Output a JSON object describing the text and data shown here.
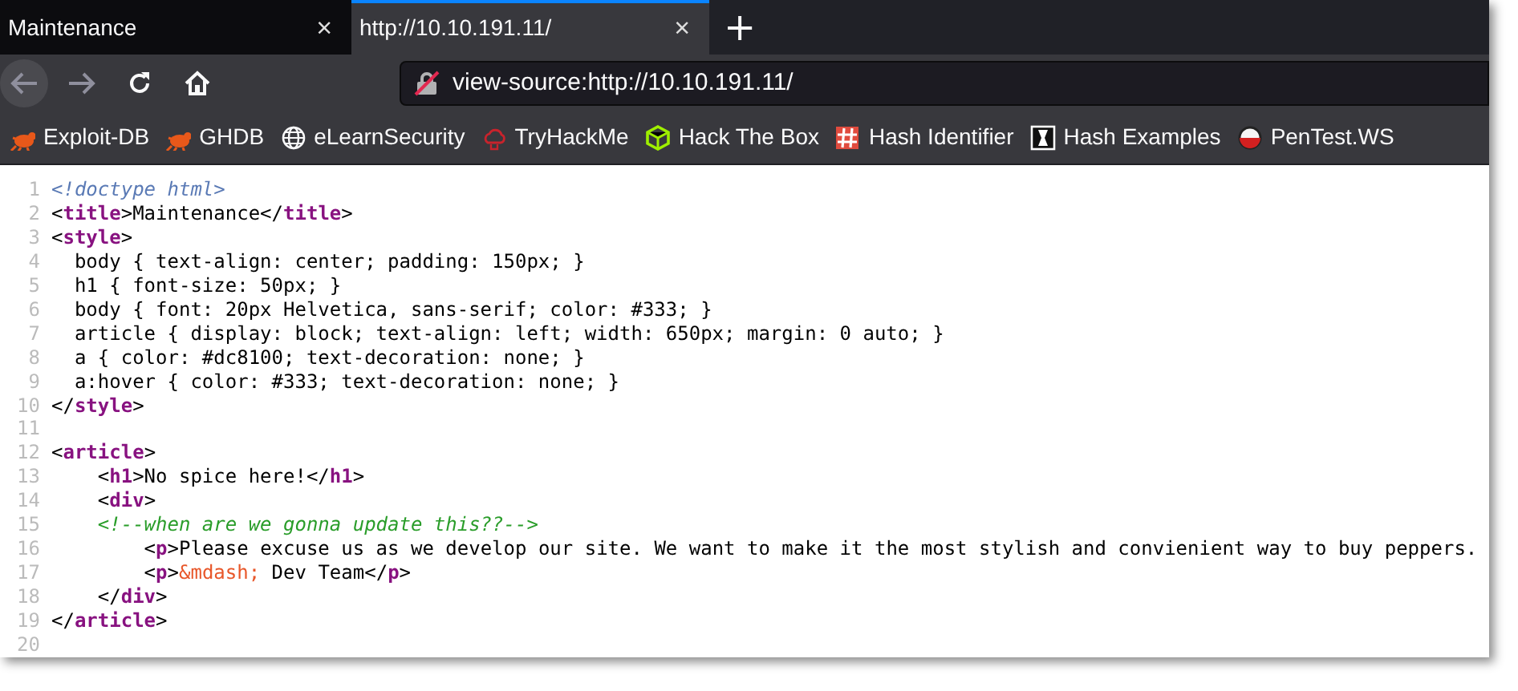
{
  "tabs": [
    {
      "label": "Maintenance",
      "selected": false,
      "close": "×"
    },
    {
      "label": "http://10.10.191.11/",
      "selected": true,
      "close": "×"
    }
  ],
  "new_tab": "+",
  "address_bar": {
    "value": "view-source:http://10.10.191.11/",
    "insecure": true
  },
  "bookmarks": [
    {
      "label": "Exploit-DB",
      "kind": "bug"
    },
    {
      "label": "GHDB",
      "kind": "bug"
    },
    {
      "label": "eLearnSecurity",
      "kind": "globe"
    },
    {
      "label": "TryHackMe",
      "kind": "cloud"
    },
    {
      "label": "Hack The Box",
      "kind": "cube"
    },
    {
      "label": "Hash Identifier",
      "kind": "hash"
    },
    {
      "label": "Hash Examples",
      "kind": "hourglass"
    },
    {
      "label": "PenTest.WS",
      "kind": "ball"
    }
  ],
  "source_lines": [
    {
      "number": "1",
      "tokens": [
        {
          "kind": "doctype",
          "text": "<!doctype html>"
        }
      ]
    },
    {
      "number": "2",
      "tokens": [
        {
          "kind": "plain",
          "text": "<"
        },
        {
          "kind": "tag",
          "text": "title"
        },
        {
          "kind": "plain",
          "text": ">Maintenance</"
        },
        {
          "kind": "tag",
          "text": "title"
        },
        {
          "kind": "plain",
          "text": ">"
        }
      ]
    },
    {
      "number": "3",
      "tokens": [
        {
          "kind": "plain",
          "text": "<"
        },
        {
          "kind": "tag",
          "text": "style"
        },
        {
          "kind": "plain",
          "text": ">"
        }
      ]
    },
    {
      "number": "4",
      "tokens": [
        {
          "kind": "plain",
          "text": "  body { text-align: center; padding: 150px; }"
        }
      ]
    },
    {
      "number": "5",
      "tokens": [
        {
          "kind": "plain",
          "text": "  h1 { font-size: 50px; }"
        }
      ]
    },
    {
      "number": "6",
      "tokens": [
        {
          "kind": "plain",
          "text": "  body { font: 20px Helvetica, sans-serif; color: #333; }"
        }
      ]
    },
    {
      "number": "7",
      "tokens": [
        {
          "kind": "plain",
          "text": "  article { display: block; text-align: left; width: 650px; margin: 0 auto; }"
        }
      ]
    },
    {
      "number": "8",
      "tokens": [
        {
          "kind": "plain",
          "text": "  a { color: #dc8100; text-decoration: none; }"
        }
      ]
    },
    {
      "number": "9",
      "tokens": [
        {
          "kind": "plain",
          "text": "  a:hover { color: #333; text-decoration: none; }"
        }
      ]
    },
    {
      "number": "10",
      "tokens": [
        {
          "kind": "plain",
          "text": "</"
        },
        {
          "kind": "tag",
          "text": "style"
        },
        {
          "kind": "plain",
          "text": ">"
        }
      ]
    },
    {
      "number": "11"
    },
    {
      "number": "12",
      "tokens": [
        {
          "kind": "plain",
          "text": "<"
        },
        {
          "kind": "tag",
          "text": "article"
        },
        {
          "kind": "plain",
          "text": ">"
        }
      ]
    },
    {
      "number": "13",
      "tokens": [
        {
          "kind": "plain",
          "text": "    <"
        },
        {
          "kind": "tag",
          "text": "h1"
        },
        {
          "kind": "plain",
          "text": ">No spice here!</"
        },
        {
          "kind": "tag",
          "text": "h1"
        },
        {
          "kind": "plain",
          "text": ">"
        }
      ]
    },
    {
      "number": "14",
      "tokens": [
        {
          "kind": "plain",
          "text": "    <"
        },
        {
          "kind": "tag",
          "text": "div"
        },
        {
          "kind": "plain",
          "text": ">"
        }
      ]
    },
    {
      "number": "15",
      "tokens": [
        {
          "kind": "comment",
          "text": "    <!--when are we gonna update this??-->"
        }
      ]
    },
    {
      "number": "16",
      "tokens": [
        {
          "kind": "plain",
          "text": "        <"
        },
        {
          "kind": "tag",
          "text": "p"
        },
        {
          "kind": "plain",
          "text": ">Please excuse us as we develop our site. We want to make it the most stylish and convienient way to buy peppers."
        }
      ]
    },
    {
      "number": "17",
      "tokens": [
        {
          "kind": "plain",
          "text": "        <"
        },
        {
          "kind": "tag",
          "text": "p"
        },
        {
          "kind": "plain",
          "text": ">"
        },
        {
          "kind": "entity",
          "text": "&mdash;"
        },
        {
          "kind": "plain",
          "text": " Dev Team</"
        },
        {
          "kind": "tag",
          "text": "p"
        },
        {
          "kind": "plain",
          "text": ">"
        }
      ]
    },
    {
      "number": "18",
      "tokens": [
        {
          "kind": "plain",
          "text": "    </"
        },
        {
          "kind": "tag",
          "text": "div"
        },
        {
          "kind": "plain",
          "text": ">"
        }
      ]
    },
    {
      "number": "19",
      "tokens": [
        {
          "kind": "plain",
          "text": "</"
        },
        {
          "kind": "tag",
          "text": "article"
        },
        {
          "kind": "plain",
          "text": ">"
        }
      ]
    },
    {
      "number": "20"
    }
  ]
}
